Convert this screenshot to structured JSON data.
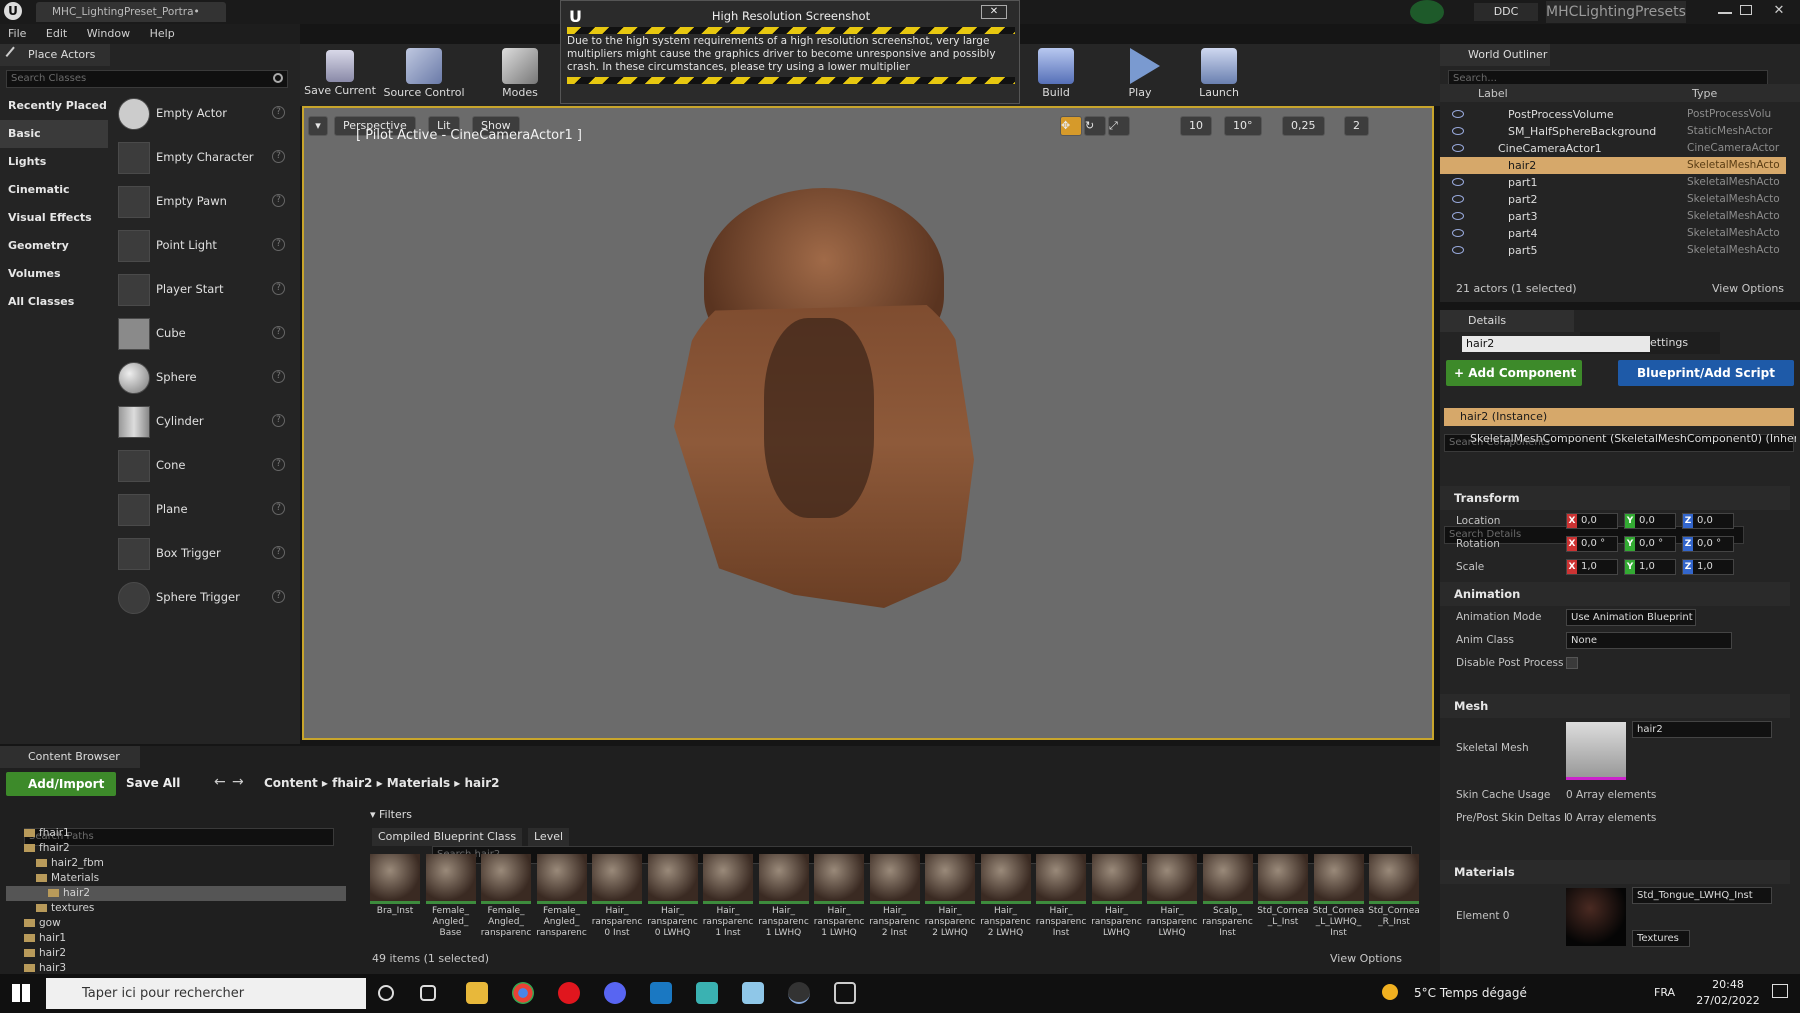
{
  "window": {
    "tab_title": "MHC_LightingPreset_Portra•",
    "project_name": "MHCLightingPresets",
    "ddc_label": "DDC"
  },
  "menu": [
    "File",
    "Edit",
    "Window",
    "Help"
  ],
  "place_actors": {
    "tab_label": "Place Actors",
    "search_placeholder": "Search Classes",
    "categories": [
      "Recently Placed",
      "Basic",
      "Lights",
      "Cinematic",
      "Visual Effects",
      "Geometry",
      "Volumes",
      "All Classes"
    ],
    "active_category": "Basic",
    "actors": [
      "Empty Actor",
      "Empty Character",
      "Empty Pawn",
      "Point Light",
      "Player Start",
      "Cube",
      "Sphere",
      "Cylinder",
      "Cone",
      "Plane",
      "Box Trigger",
      "Sphere Trigger"
    ]
  },
  "toolbar": {
    "save_current": "Save Current",
    "source_control": "Source Control",
    "modes": "Modes",
    "build": "Build",
    "play": "Play",
    "launch": "Launch"
  },
  "notification": {
    "title": "High Resolution Screenshot",
    "body": "Due to the high system requirements of a high resolution screenshot, very large multipliers might cause the graphics driver to become unresponsive and possibly crash. In these circumstances, please try using a lower multiplier",
    "close": "✕"
  },
  "viewport": {
    "perspective": "Perspective",
    "lit": "Lit",
    "show": "Show",
    "pilot_label": "[ Pilot Active - CineCameraActor1 ]",
    "grid_snap": "10",
    "rot_snap": "10°",
    "scale_snap": "0,25",
    "cam_speed": "2"
  },
  "outliner": {
    "tab_label": "World Outliner",
    "search_placeholder": "Search...",
    "col_label": "Label",
    "col_type": "Type",
    "rows": [
      {
        "label": "PostProcessVolume",
        "type": "PostProcessVolu"
      },
      {
        "label": "SM_HalfSphereBackground",
        "type": "StaticMeshActor"
      },
      {
        "label": "CineCameraActor1",
        "type": "CineCameraActor"
      },
      {
        "label": "hair2",
        "type": "SkeletalMeshActo"
      },
      {
        "label": "part1",
        "type": "SkeletalMeshActo"
      },
      {
        "label": "part2",
        "type": "SkeletalMeshActo"
      },
      {
        "label": "part3",
        "type": "SkeletalMeshActo"
      },
      {
        "label": "part4",
        "type": "SkeletalMeshActo"
      },
      {
        "label": "part5",
        "type": "SkeletalMeshActo"
      }
    ],
    "selected_row": "hair2",
    "status": "21 actors (1 selected)",
    "view_options": "View Options"
  },
  "details": {
    "tab_details": "Details",
    "tab_world_settings": "World Settings",
    "name_value": "hair2",
    "add_component": "+ Add Component",
    "blueprint_script": "Blueprint/Add Script",
    "search_components": "Search Components",
    "instance_label": "hair2 (Instance)",
    "component_label": "SkeletalMeshComponent (SkeletalMeshComponent0) (Inherited)",
    "search_details": "Search Details",
    "transform": {
      "heading": "Transform",
      "location_label": "Location",
      "rotation_label": "Rotation",
      "scale_label": "Scale",
      "location": [
        "0,0",
        "0,0",
        "0,0"
      ],
      "rotation": [
        "0,0 °",
        "0,0 °",
        "0,0 °"
      ],
      "scale": [
        "1,0",
        "1,0",
        "1,0"
      ]
    },
    "animation": {
      "heading": "Animation",
      "mode_label": "Animation Mode",
      "mode_value": "Use Animation Blueprint",
      "class_label": "Anim Class",
      "class_value": "None",
      "disable_pp_label": "Disable Post Process"
    },
    "mesh": {
      "heading": "Mesh",
      "skeletal_label": "Skeletal Mesh",
      "skeletal_value": "hair2",
      "skin_cache_label": "Skin Cache Usage",
      "skin_cache_value": "0 Array elements",
      "prepost_label": "Pre/Post Skin Deltas I",
      "prepost_value": "0 Array elements"
    },
    "materials": {
      "heading": "Materials",
      "element_label": "Element 0",
      "element_value": "Std_Tongue_LWHQ_Inst",
      "textures": "Textures"
    }
  },
  "content_browser": {
    "tab_label": "Content Browser",
    "add_import": "Add/Import",
    "save_all": "Save All",
    "path": [
      "Content",
      "fhair2",
      "Materials",
      "hair2"
    ],
    "search_paths": "Search Paths",
    "filters": "Filters",
    "search_assets": "Search hair2",
    "filter_chips": [
      "Compiled Blueprint Class",
      "Level"
    ],
    "folders": [
      {
        "name": "fhair1",
        "indent": 1
      },
      {
        "name": "fhair2",
        "indent": 1
      },
      {
        "name": "hair2_fbm",
        "indent": 2
      },
      {
        "name": "Materials",
        "indent": 2
      },
      {
        "name": "hair2",
        "indent": 3
      },
      {
        "name": "textures",
        "indent": 2
      },
      {
        "name": "gow",
        "indent": 1
      },
      {
        "name": "hair1",
        "indent": 1
      },
      {
        "name": "hair2",
        "indent": 1
      },
      {
        "name": "hair3",
        "indent": 1
      }
    ],
    "assets": [
      "Bra_Inst",
      "Female_ Angled_ Base",
      "Female_ Angled_ ransparenc",
      "Female_ Angled_ ransparenc",
      "Hair_ ransparenc 0 Inst",
      "Hair_ ransparenc 0 LWHQ",
      "Hair_ ransparenc 1 Inst",
      "Hair_ ransparenc 1 LWHQ",
      "Hair_ ransparenc 1 LWHQ",
      "Hair_ ransparenc 2 Inst",
      "Hair_ ransparenc 2 LWHQ",
      "Hair_ ransparenc 2 LWHQ",
      "Hair_ ransparenc Inst",
      "Hair_ ransparenc LWHQ",
      "Hair_ ransparenc LWHQ",
      "Scalp_ ransparenc Inst",
      "Std_Cornea _L_Inst",
      "Std_Cornea _L_LWHQ_ Inst",
      "Std_Cornea _R_Inst"
    ],
    "status": "49 items (1 selected)",
    "view_options": "View Options"
  },
  "taskbar": {
    "search_placeholder": "Taper ici pour rechercher",
    "weather": "5°C Temps dégagé",
    "lang": "FRA",
    "time": "20:48",
    "date": "27/02/2022"
  }
}
